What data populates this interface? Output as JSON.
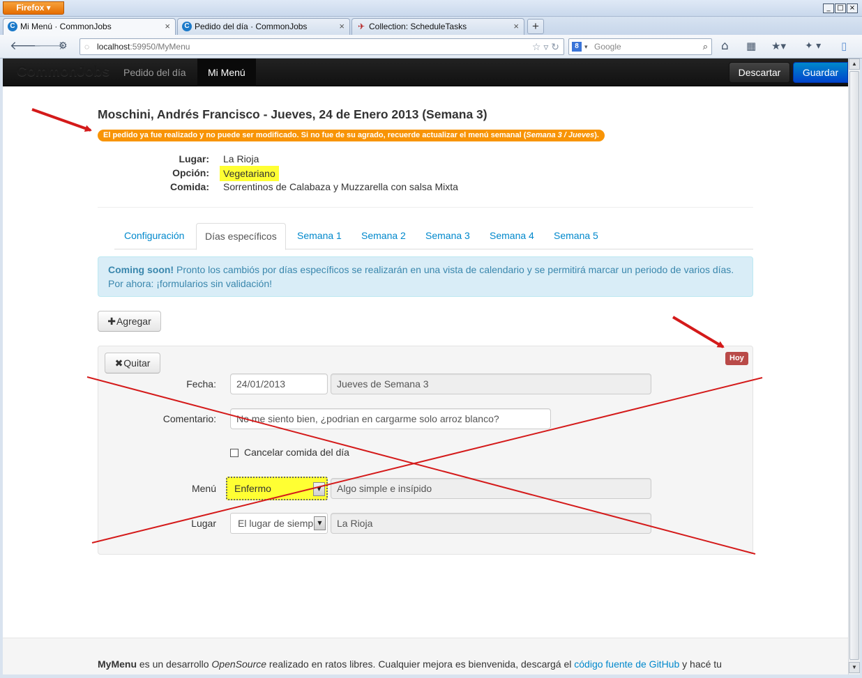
{
  "browser": {
    "menu_button": "Firefox",
    "tabs": [
      {
        "title": "Mi Menú · CommonJobs",
        "favicon": "C"
      },
      {
        "title": "Pedido del día · CommonJobs",
        "favicon": "C"
      },
      {
        "title": "Collection: ScheduleTasks",
        "favicon": "✈"
      }
    ],
    "tab_close": "×",
    "new_tab": "+",
    "url_host": "localhost",
    "url_path": ":59950/MyMenu",
    "search_placeholder": "Google",
    "search_engine_icon": "8",
    "window_controls": [
      "_",
      "□",
      "×"
    ]
  },
  "app": {
    "brand": "CommonJobs",
    "nav": [
      {
        "label": "Pedido del día"
      },
      {
        "label": "Mi Menú"
      }
    ],
    "discard_label": "Descartar",
    "save_label": "Guardar"
  },
  "page": {
    "title": "Moschini, Andrés Francisco - Jueves, 24 de Enero 2013 (Semana 3)",
    "alert_text": "El pedido ya fue realizado y no puede ser modificado. Si no fue de su agrado, recuerde actualizar el menú semanal (",
    "alert_emph": "Semana 3 / Jueves",
    "alert_end": ").",
    "info": {
      "lugar_label": "Lugar:",
      "lugar_value": "La Rioja",
      "opcion_label": "Opción:",
      "opcion_value": "Vegetariano",
      "comida_label": "Comida:",
      "comida_value": "Sorrentinos de Calabaza y Muzzarella con salsa Mixta"
    },
    "tabs": [
      {
        "label": "Configuración"
      },
      {
        "label": "Días específicos"
      },
      {
        "label": "Semana 1"
      },
      {
        "label": "Semana 2"
      },
      {
        "label": "Semana 3"
      },
      {
        "label": "Semana 4"
      },
      {
        "label": "Semana 5"
      }
    ],
    "info_alert_bold": "Coming soon!",
    "info_alert_text": " Pronto los cambiós por días específicos se realizarán en una vista de calendario y se permitirá marcar un periodo de varios días. Por ahora: ¡formularios sin validación!",
    "add_label": "Agregar",
    "remove_label": "Quitar",
    "badge_today": "Hoy",
    "form": {
      "fecha_label": "Fecha:",
      "fecha_value": "24/01/2013",
      "fecha_desc": "Jueves de Semana 3",
      "comentario_label": "Comentario:",
      "comentario_value": "No me siento bien, ¿podrian en cargarme solo arroz blanco?",
      "cancel_label": "Cancelar comida del día",
      "menu_label": "Menú",
      "menu_value": "Enfermo",
      "menu_desc": "Algo simple e insípido",
      "lugar_label": "Lugar",
      "lugar_value": "El lugar de siemp",
      "lugar_desc": "La Rioja"
    },
    "footer": {
      "brand": "MyMenu",
      "t1": " es un desarrollo ",
      "t2": "OpenSource",
      "t3": " realizado en ratos libres. Cualquier mejora es bienvenida, descargá el ",
      "link": "código fuente de GitHub",
      "t4": " y hacé tu"
    }
  },
  "colors": {
    "annotation": "#d41a1a",
    "highlight": "#ffff33",
    "warning": "#f89406",
    "link": "#0088cc"
  }
}
